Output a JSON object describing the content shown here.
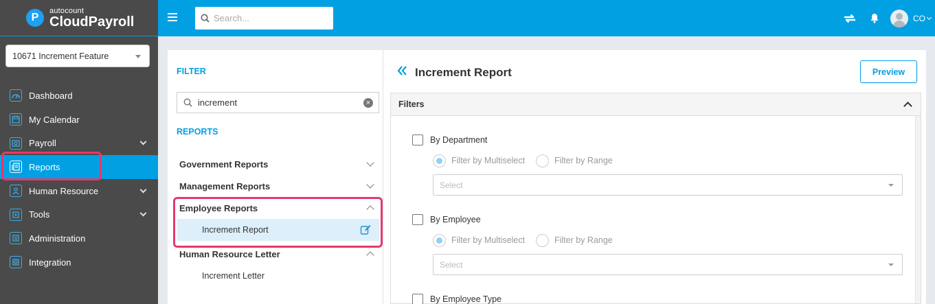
{
  "app": {
    "logo_small": "autocount",
    "logo_big": "CloudPayroll",
    "logo_letter": "P"
  },
  "company": {
    "selected": "10671 Increment Feature"
  },
  "sidebar": {
    "items": [
      {
        "label": "Dashboard",
        "icon": "dashboard-icon",
        "has_children": false
      },
      {
        "label": "My Calendar",
        "icon": "calendar-icon",
        "has_children": false
      },
      {
        "label": "Payroll",
        "icon": "payroll-icon",
        "has_children": true
      },
      {
        "label": "Reports",
        "icon": "reports-icon",
        "has_children": false,
        "active": true
      },
      {
        "label": "Human Resource",
        "icon": "human-resource-icon",
        "has_children": true
      },
      {
        "label": "Tools",
        "icon": "tools-icon",
        "has_children": true
      },
      {
        "label": "Administration",
        "icon": "administration-icon",
        "has_children": false
      },
      {
        "label": "Integration",
        "icon": "integration-icon",
        "has_children": false
      }
    ]
  },
  "topbar": {
    "search_placeholder": "Search...",
    "user_initials": "CO"
  },
  "filter_panel": {
    "filter_title": "FILTER",
    "search_value": "increment",
    "reports_title": "REPORTS",
    "groups": [
      {
        "label": "Government Reports",
        "expanded": false
      },
      {
        "label": "Management Reports",
        "expanded": false
      },
      {
        "label": "Employee Reports",
        "expanded": true,
        "items": [
          "Increment Report"
        ]
      },
      {
        "label": "Human Resource Letter",
        "expanded": true,
        "items": [
          "Increment Letter"
        ]
      }
    ]
  },
  "main": {
    "title": "Increment Report",
    "preview_label": "Preview",
    "filters_heading": "Filters",
    "filter_groups": [
      {
        "label": "By Department",
        "radio_multiselect": "Filter by Multiselect",
        "radio_range": "Filter by Range",
        "select_placeholder": "Select"
      },
      {
        "label": "By Employee",
        "radio_multiselect": "Filter by Multiselect",
        "radio_range": "Filter by Range",
        "select_placeholder": "Select"
      },
      {
        "label": "By Employee Type"
      }
    ]
  },
  "colors": {
    "accent": "#00a0e3",
    "sidebar_bg": "#4a4a4a",
    "highlight": "#e8386d",
    "selected_row": "#dceffa"
  }
}
